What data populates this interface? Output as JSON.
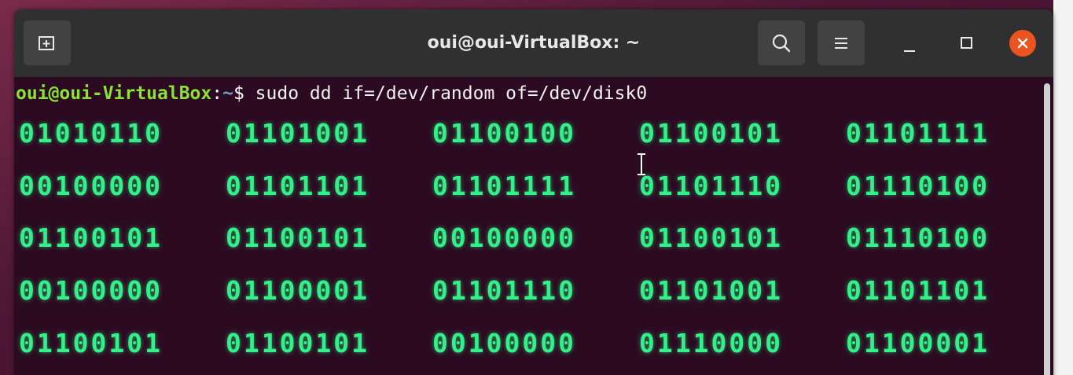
{
  "window": {
    "title": "oui@oui-VirtualBox: ~",
    "buttons": [
      "new-tab",
      "search",
      "menu",
      "minimize",
      "maximize",
      "close"
    ]
  },
  "colors": {
    "terminal_bg": "#2c0b22",
    "titlebar_bg": "#303030",
    "prompt_user": "#8ae234",
    "prompt_path": "#729fcf",
    "binary_text": "#33f08a",
    "close_button": "#e95420"
  },
  "prompt": {
    "user_host": "oui@oui-VirtualBox",
    "colon": ":",
    "path": "~",
    "sign": "$",
    "command": " sudo dd if=/dev/random of=/dev/disk0"
  },
  "output": {
    "rows": [
      [
        "01010110",
        "01101001",
        "01100100",
        "01100101",
        "01101111"
      ],
      [
        "00100000",
        "01101101",
        "01101111",
        "01101110",
        "01110100"
      ],
      [
        "01100101",
        "01100101",
        "00100000",
        "01100101",
        "01110100"
      ],
      [
        "00100000",
        "01100001",
        "01101110",
        "01101001",
        "01101101"
      ],
      [
        "01100101",
        "01100101",
        "00100000",
        "01110000",
        "01100001"
      ]
    ]
  }
}
